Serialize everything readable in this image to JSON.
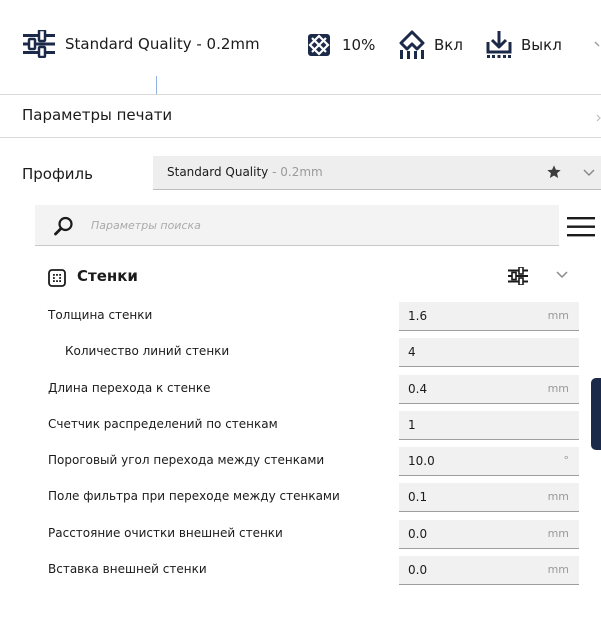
{
  "topbar": {
    "profile_label": "Standard Quality - 0.2mm",
    "infill_value": "10%",
    "support_label": "Вкл",
    "adhesion_label": "Выкл"
  },
  "section": {
    "title": "Параметры печати"
  },
  "profile": {
    "label": "Профиль",
    "selected_main": "Standard Quality",
    "selected_sub": " - 0.2mm"
  },
  "search": {
    "placeholder": "Параметры поиска",
    "value": ""
  },
  "walls": {
    "title": "Стенки"
  },
  "settings": [
    {
      "label": "Толщина стенки",
      "value": "1.6",
      "unit": "mm",
      "indent": false
    },
    {
      "label": "Количество линий стенки",
      "value": "4",
      "unit": "",
      "indent": true
    },
    {
      "label": "Длина перехода к стенке",
      "value": "0.4",
      "unit": "mm",
      "indent": false
    },
    {
      "label": "Счетчик распределений по стенкам",
      "value": "1",
      "unit": "",
      "indent": false
    },
    {
      "label": "Пороговый угол перехода между стенками",
      "value": "10.0",
      "unit": "°",
      "indent": false
    },
    {
      "label": "Поле фильтра при переходе между стенками",
      "value": "0.1",
      "unit": "mm",
      "indent": false
    },
    {
      "label": "Расстояние очистки внешней стенки",
      "value": "0.0",
      "unit": "mm",
      "indent": false
    },
    {
      "label": "Вставка внешней стенки",
      "value": "0.0",
      "unit": "mm",
      "indent": false
    }
  ],
  "colors": {
    "accent": "#1c2a4a",
    "field_bg": "#f1f1f1",
    "divider": "#d9d9d9"
  },
  "icons": {
    "profile": "sliders-icon",
    "infill": "infill-icon",
    "support": "support-icon",
    "adhesion": "adhesion-icon",
    "search": "search-icon",
    "menu": "hamburger-icon",
    "walls": "walls-icon",
    "visibility": "settings-sliders-icon",
    "collapse": "chevron-down-icon",
    "favorite": "star-icon"
  }
}
